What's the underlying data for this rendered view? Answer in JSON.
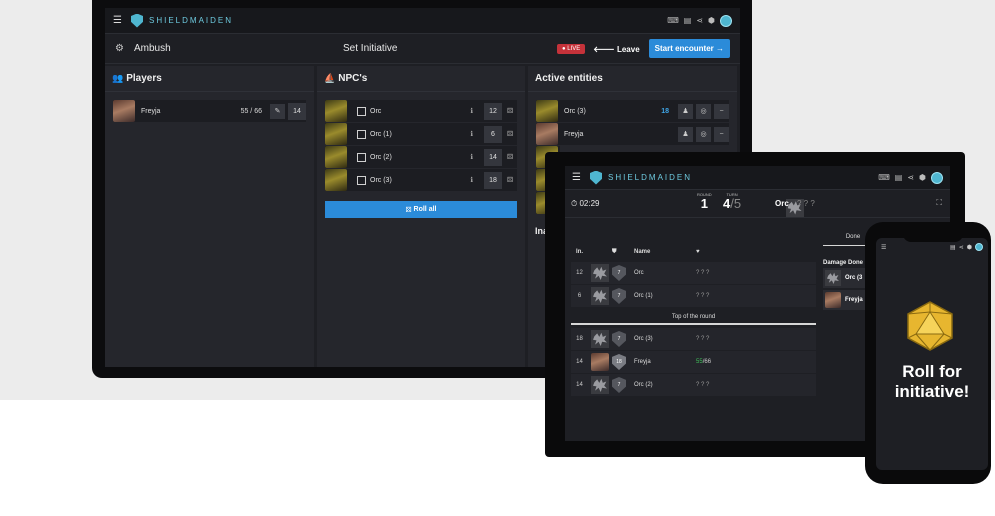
{
  "laptop": {
    "topbar": {
      "brand": "SHIELDMAIDEN"
    },
    "toolbar": {
      "encounter_name": "Ambush",
      "title": "Set Initiative",
      "live_label": "LIVE",
      "leave_label": "Leave",
      "start_label": "Start encounter"
    },
    "players": {
      "heading": "Players",
      "rows": [
        {
          "name": "Freyja",
          "hp": "55 / 66",
          "initiative": "14"
        }
      ]
    },
    "npcs": {
      "heading": "NPC's",
      "rows": [
        {
          "name": "Orc",
          "initiative": "12"
        },
        {
          "name": "Orc (1)",
          "initiative": "6"
        },
        {
          "name": "Orc (2)",
          "initiative": "14"
        },
        {
          "name": "Orc (3)",
          "initiative": "18"
        }
      ],
      "roll_all_label": "Roll all"
    },
    "active": {
      "heading": "Active entities",
      "rows": [
        {
          "name": "Orc (3)",
          "initiative": "18"
        },
        {
          "name": "Freyja",
          "initiative": ""
        }
      ],
      "inactive_heading": "Ina"
    }
  },
  "tablet": {
    "brand": "SHIELDMAIDEN",
    "timer": "02:29",
    "round_label": "ROUND",
    "round_value": "1",
    "turn_label": "TURN",
    "turn_value": "4",
    "turn_total": "/5",
    "current_name": "Orc",
    "current_hp": "? ? ?",
    "table": {
      "headers": {
        "init": "In.",
        "name": "Name"
      },
      "rows_before": [
        {
          "init": "12",
          "ac": "7",
          "name": "Orc",
          "hp": "? ? ?"
        },
        {
          "init": "6",
          "ac": "7",
          "name": "Orc (1)",
          "hp": "? ? ?"
        }
      ],
      "top_of_round": "Top of the round",
      "rows_after": [
        {
          "init": "18",
          "ac": "7",
          "name": "Orc (3)",
          "hp": "? ? ?"
        },
        {
          "init": "14",
          "ac": "18",
          "name": "Freyja",
          "hp_current": "55",
          "hp_max": "/66"
        },
        {
          "init": "14",
          "ac": "7",
          "name": "Orc (2)",
          "hp": "? ? ?"
        }
      ]
    },
    "side": {
      "done_tab": "Done",
      "damage_heading": "Damage Done",
      "rows": [
        {
          "name": "Orc (3"
        },
        {
          "name": "Freyja"
        }
      ]
    }
  },
  "phone": {
    "line1": "Roll for",
    "line2": "initiative!"
  },
  "colors": {
    "accent": "#2b8bd9",
    "brand": "#4fb6d0",
    "live": "#c5323a",
    "hp_good": "#3fbf5a",
    "d20": "#e7b62f"
  }
}
